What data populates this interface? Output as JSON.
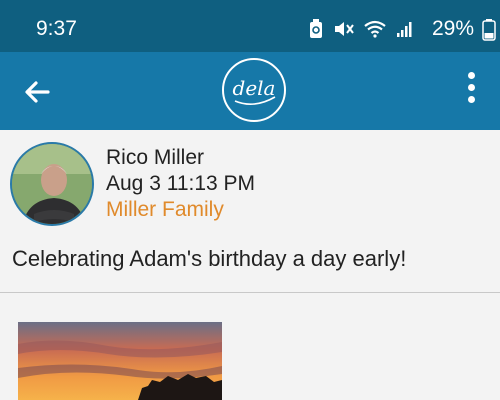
{
  "status": {
    "time": "9:37",
    "battery": "29%"
  },
  "app": {
    "logo_text": "dela"
  },
  "post": {
    "author": "Rico Miller",
    "timestamp": "Aug 3 11:13 PM",
    "group": "Miller Family",
    "text": "Celebrating Adam's birthday a day early!"
  },
  "colors": {
    "status_bar": "#0f5f80",
    "app_bar": "#1678a8",
    "accent": "#e08a2b"
  }
}
